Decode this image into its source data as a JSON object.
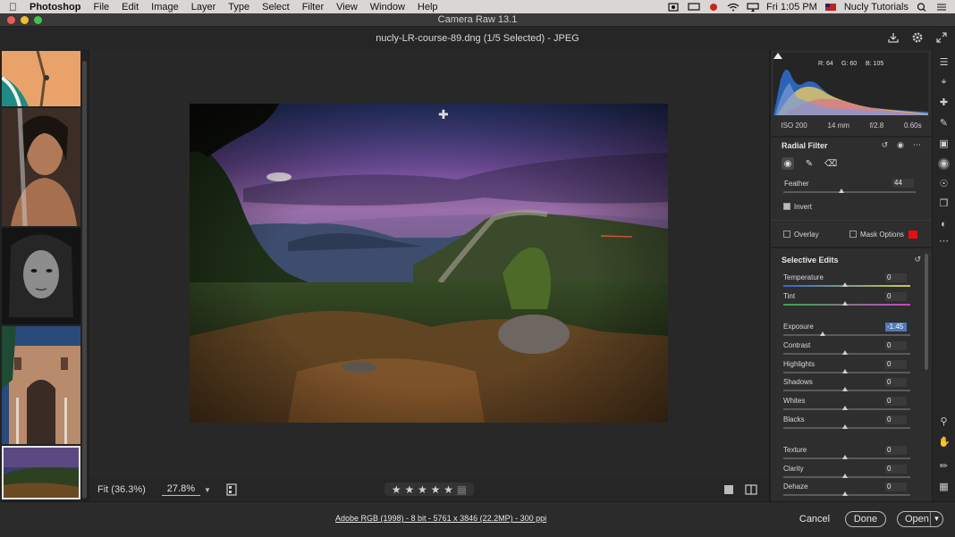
{
  "menubar": {
    "app_name": "Photoshop",
    "items": [
      "File",
      "Edit",
      "Image",
      "Layer",
      "Type",
      "Select",
      "Filter",
      "View",
      "Window",
      "Help"
    ],
    "clock": "Fri 1:05 PM",
    "user": "Nucly Tutorials"
  },
  "window": {
    "title": "Camera Raw 13.1"
  },
  "filebar": {
    "filename": "nucly-LR-course-89.dng (1/5 Selected)  -  JPEG"
  },
  "canvas": {
    "zoom_fit": "Fit (36.3%)",
    "zoom_value": "27.8%"
  },
  "histogram": {
    "r": "R: 64",
    "g": "G: 60",
    "b": "B: 105"
  },
  "camera_info": {
    "iso": "ISO 200",
    "focal": "14 mm",
    "aperture": "f/2.8",
    "shutter": "0.60s"
  },
  "radial_filter": {
    "title": "Radial Filter",
    "feather_label": "Feather",
    "feather_value": "44",
    "feather_fraction": 0.44,
    "invert_label": "Invert",
    "invert_checked": true,
    "overlay_label": "Overlay",
    "mask_options_label": "Mask Options",
    "mask_color": "#e80d0d"
  },
  "selective_edits": {
    "title": "Selective Edits",
    "sliders": [
      {
        "label": "Temperature",
        "value": "0"
      },
      {
        "label": "Tint",
        "value": "0"
      },
      {
        "label": "Exposure",
        "value": "-1.45"
      },
      {
        "label": "Contrast",
        "value": "0"
      },
      {
        "label": "Highlights",
        "value": "0"
      },
      {
        "label": "Shadows",
        "value": "0"
      },
      {
        "label": "Whites",
        "value": "0"
      },
      {
        "label": "Blacks",
        "value": "0"
      },
      {
        "label": "Texture",
        "value": "0"
      },
      {
        "label": "Clarity",
        "value": "0"
      },
      {
        "label": "Dehaze",
        "value": "0"
      }
    ]
  },
  "statusbar": {
    "info": "Adobe RGB (1998) - 8 bit - 5761 x 3846 (22.2MP) - 300 ppi",
    "cancel": "Cancel",
    "done": "Done",
    "open": "Open"
  },
  "accent": {
    "traffic_red": "#ee5b56",
    "traffic_yellow": "#f0be2e",
    "traffic_green": "#3ec645",
    "highlight_blue": "#4f79b8"
  }
}
